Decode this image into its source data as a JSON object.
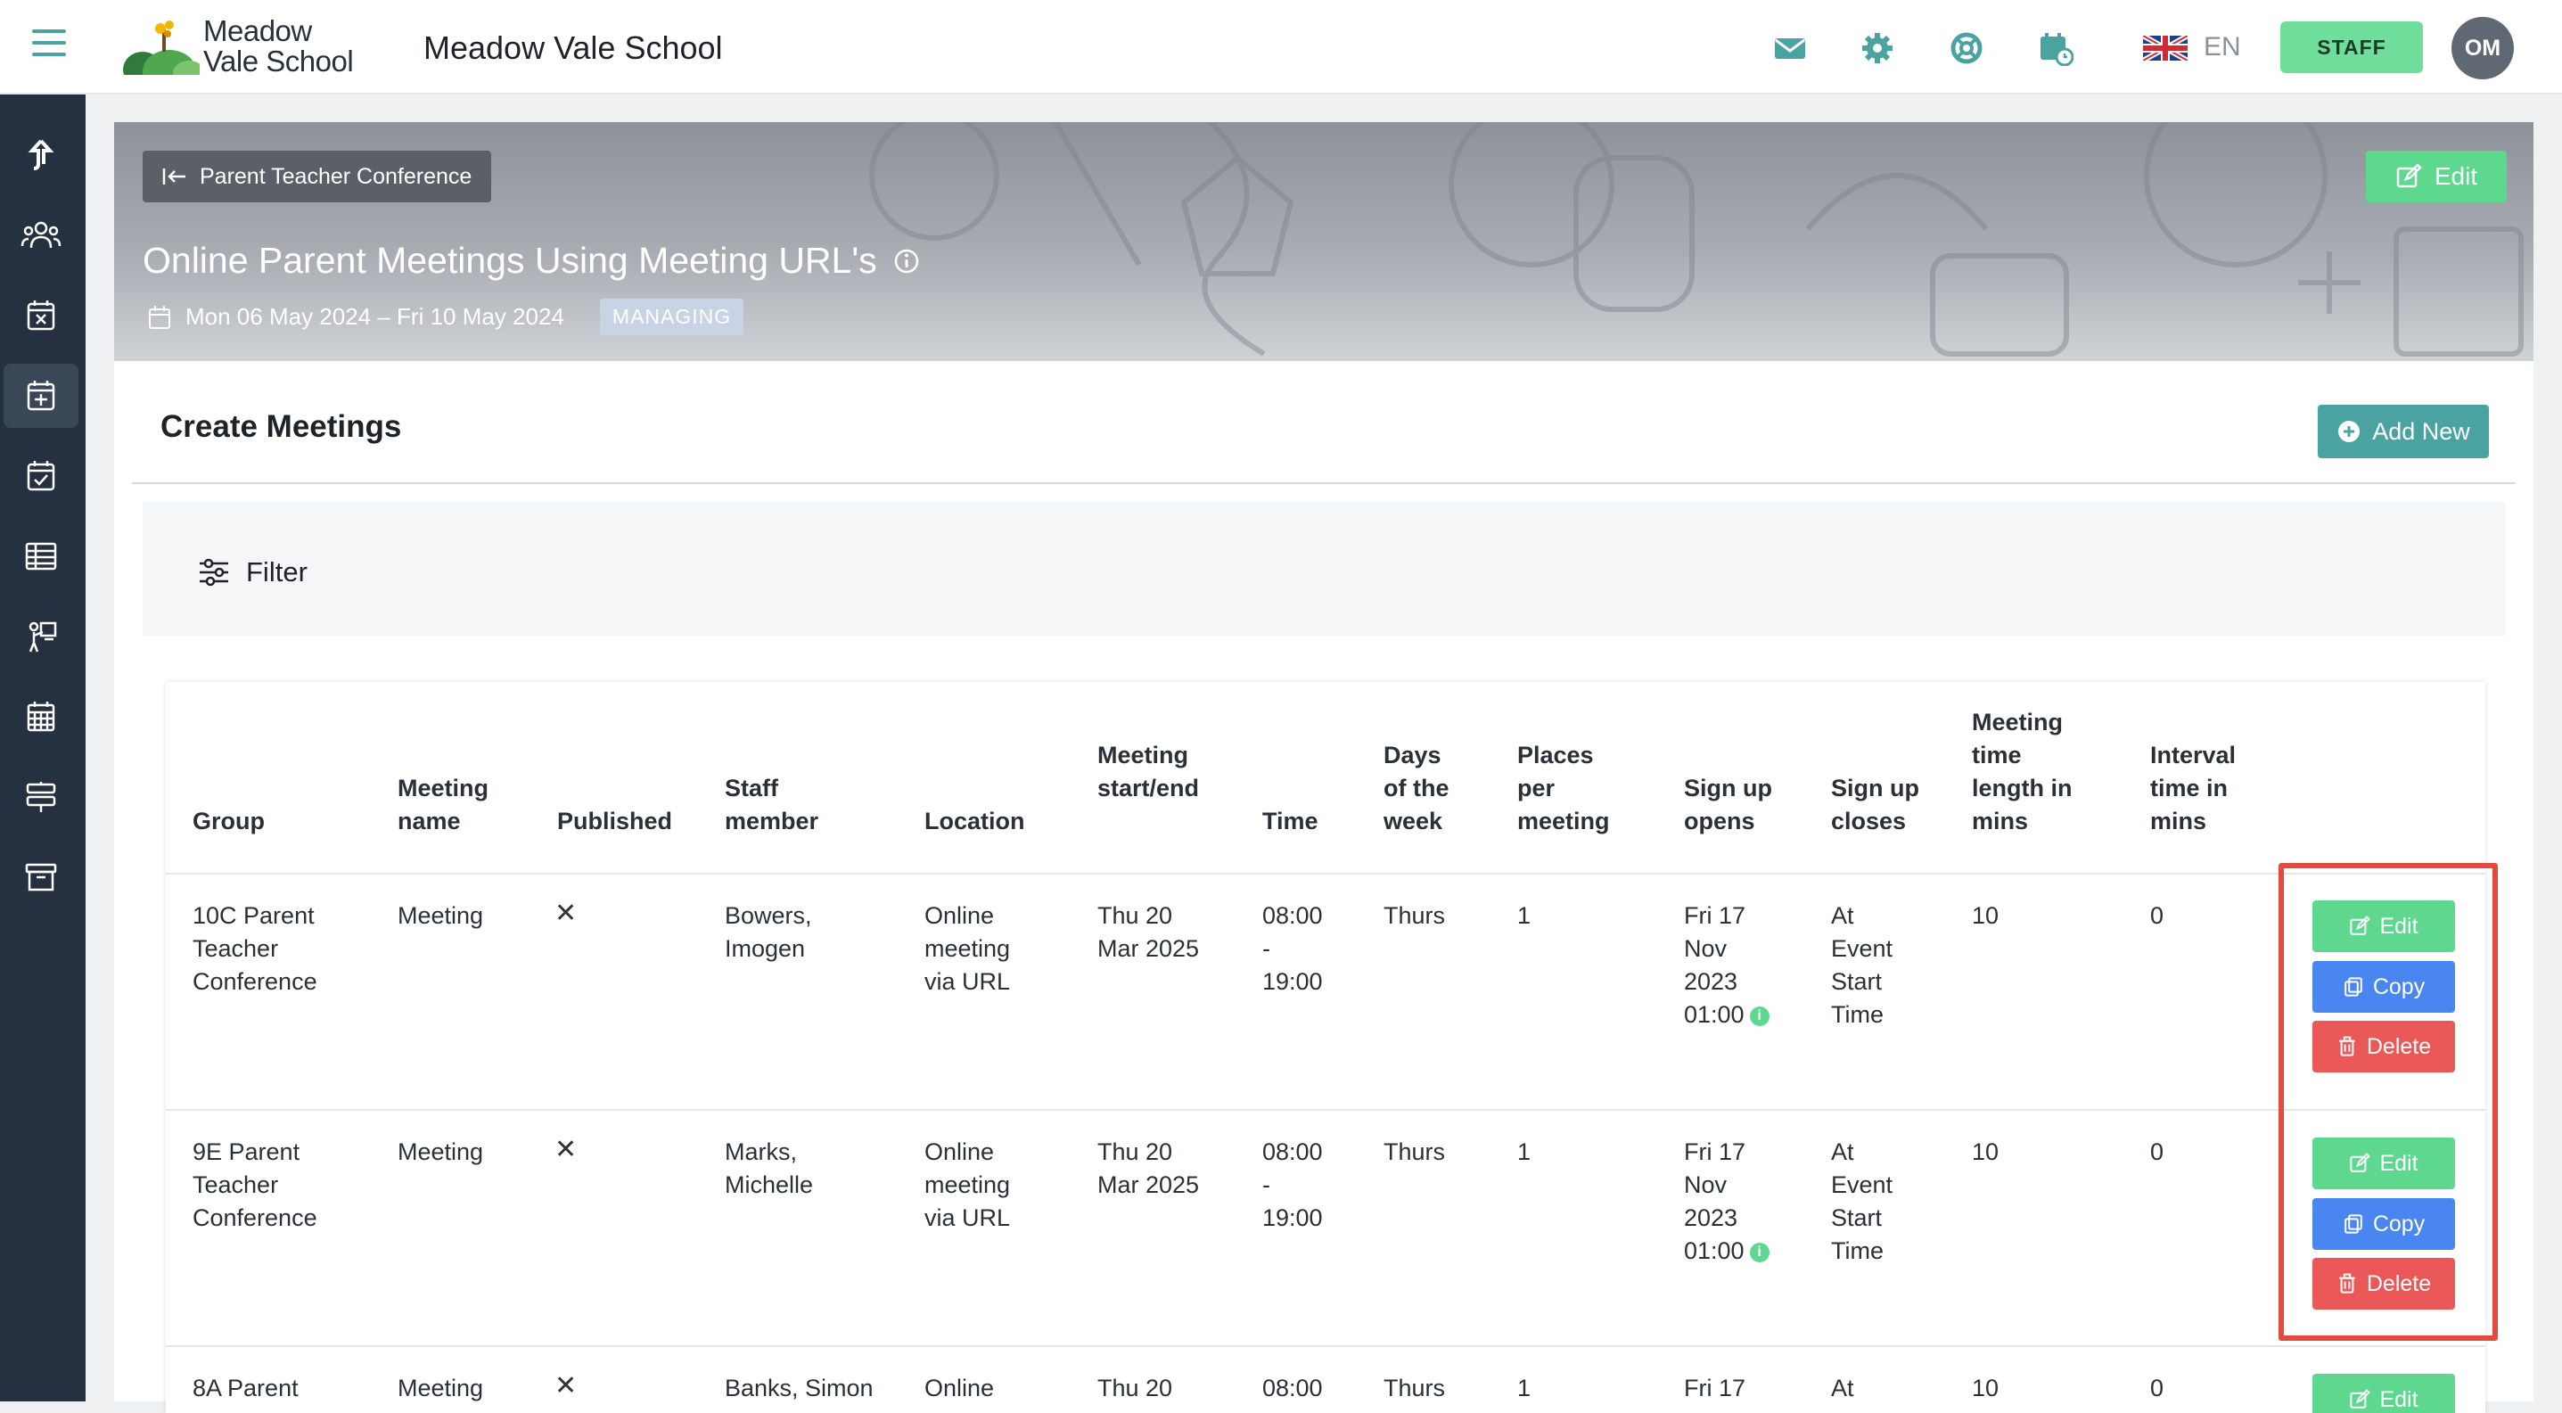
{
  "header": {
    "logo_text_line1": "Meadow",
    "logo_text_line2": "Vale School",
    "school_name": "Meadow Vale School",
    "language": "EN",
    "staff_label": "STAFF",
    "avatar_initials": "OM",
    "icons": [
      "mail-icon",
      "gear-icon",
      "lifebuoy-icon",
      "calendar-clock-icon"
    ]
  },
  "banner": {
    "back_label": "Parent Teacher Conference",
    "edit_label": "Edit",
    "title": "Online Parent Meetings Using Meeting URL's",
    "date_range": "Mon 06 May 2024 – Fri 10 May 2024",
    "badge": "MANAGING"
  },
  "section": {
    "title": "Create Meetings",
    "add_new_label": "Add New",
    "filter_label": "Filter"
  },
  "table": {
    "headers": {
      "group": "Group",
      "meeting_name": [
        "Meeting",
        "name"
      ],
      "published": "Published",
      "staff_member": [
        "Staff",
        "member"
      ],
      "location": "Location",
      "meeting_start_end": [
        "Meeting",
        "start/end"
      ],
      "time": "Time",
      "days_of_week": [
        "Days",
        "of the",
        "week"
      ],
      "places_per_meeting": [
        "Places",
        "per",
        "meeting"
      ],
      "sign_up_opens": [
        "Sign up",
        "opens"
      ],
      "sign_up_closes": [
        "Sign up",
        "closes"
      ],
      "meeting_length": [
        "Meeting",
        "time",
        "length in",
        "mins"
      ],
      "interval_time": [
        "Interval",
        "time in",
        "mins"
      ]
    },
    "rows": [
      {
        "group": [
          "10C Parent",
          "Teacher",
          "Conference"
        ],
        "meeting_name": "Meeting",
        "published": "✕",
        "staff_member": [
          "Bowers,",
          "Imogen"
        ],
        "location": [
          "Online",
          "meeting",
          "via URL"
        ],
        "start_end": [
          "Thu 20",
          "Mar 2025"
        ],
        "time": [
          "08:00",
          "-",
          "19:00"
        ],
        "days": "Thurs",
        "places": "1",
        "opens": [
          "Fri 17",
          "Nov",
          "2023",
          "01:00"
        ],
        "closes": [
          "At",
          "Event",
          "Start",
          "Time"
        ],
        "length": "10",
        "interval": "0"
      },
      {
        "group": [
          "9E Parent",
          "Teacher",
          "Conference"
        ],
        "meeting_name": "Meeting",
        "published": "✕",
        "staff_member": [
          "Marks,",
          "Michelle"
        ],
        "location": [
          "Online",
          "meeting",
          "via URL"
        ],
        "start_end": [
          "Thu 20",
          "Mar 2025"
        ],
        "time": [
          "08:00",
          "-",
          "19:00"
        ],
        "days": "Thurs",
        "places": "1",
        "opens": [
          "Fri 17",
          "Nov",
          "2023",
          "01:00"
        ],
        "closes": [
          "At",
          "Event",
          "Start",
          "Time"
        ],
        "length": "10",
        "interval": "0"
      },
      {
        "group": [
          "8A Parent"
        ],
        "meeting_name": "Meeting",
        "published": "✕",
        "staff_member": [
          "Banks, Simon"
        ],
        "location": [
          "Online"
        ],
        "start_end": [
          "Thu 20"
        ],
        "time": [
          "08:00"
        ],
        "days": "Thurs",
        "places": "1",
        "opens": [
          "Fri 17"
        ],
        "closes": [
          "At"
        ],
        "length": "10",
        "interval": "0"
      }
    ],
    "actions": {
      "edit": "Edit",
      "copy": "Copy",
      "delete": "Delete"
    }
  },
  "colors": {
    "accent_teal": "#4aa3a1",
    "sidebar": "#253140",
    "edit_green": "#5ed88f",
    "copy_blue": "#4a86f0",
    "delete_red": "#ea5858",
    "highlight_red": "#e24b3f"
  }
}
